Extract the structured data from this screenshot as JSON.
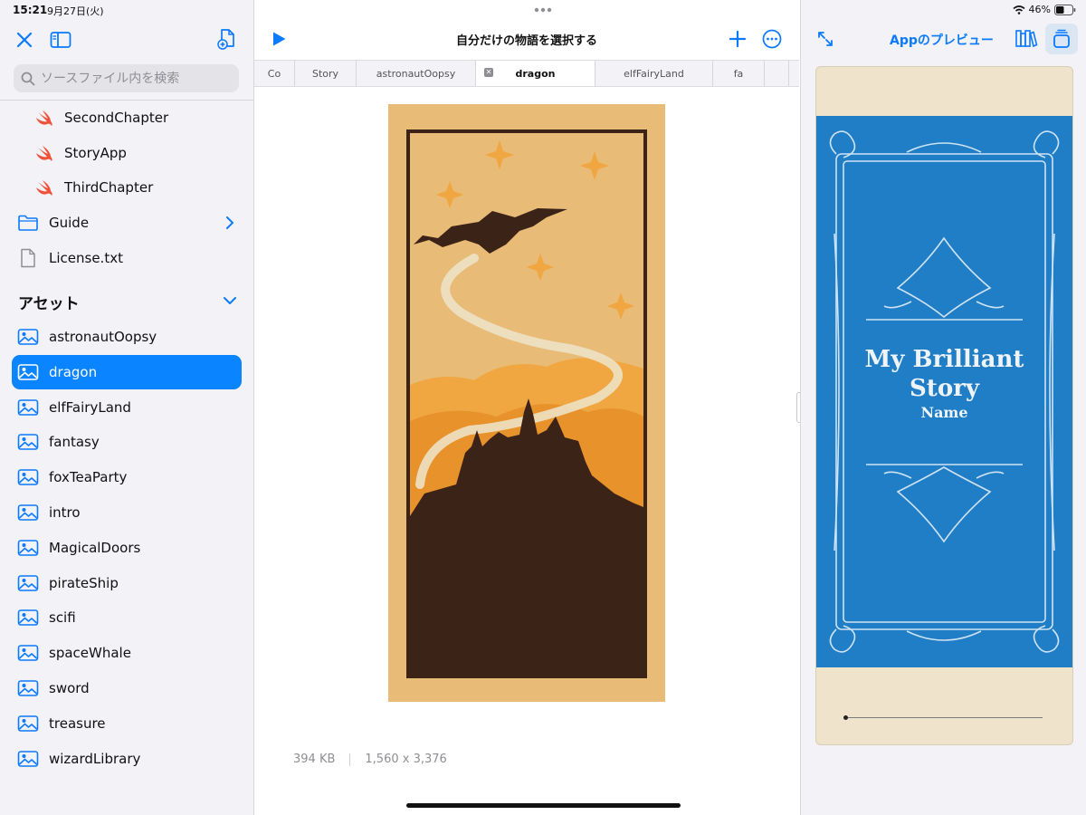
{
  "status": {
    "time": "15:21",
    "date": "9月27日(火)",
    "battery": "46%"
  },
  "sidebar": {
    "search_placeholder": "ソースファイル内を検索",
    "files": [
      {
        "label": "SecondChapter"
      },
      {
        "label": "StoryApp"
      },
      {
        "label": "ThirdChapter"
      },
      {
        "label": "Guide"
      },
      {
        "label": "License.txt"
      }
    ],
    "assets_title": "アセット",
    "assets": [
      {
        "label": "astronautOopsy"
      },
      {
        "label": "dragon"
      },
      {
        "label": "elfFairyLand"
      },
      {
        "label": "fantasy"
      },
      {
        "label": "foxTeaParty"
      },
      {
        "label": "intro"
      },
      {
        "label": "MagicalDoors"
      },
      {
        "label": "pirateShip"
      },
      {
        "label": "scifi"
      },
      {
        "label": "spaceWhale"
      },
      {
        "label": "sword"
      },
      {
        "label": "treasure"
      },
      {
        "label": "wizardLibrary"
      }
    ],
    "selected_asset": "dragon"
  },
  "editor": {
    "title": "自分だけの物語を選択する",
    "tabs": [
      {
        "label": "Co"
      },
      {
        "label": "Story"
      },
      {
        "label": "astronautOopsy"
      },
      {
        "label": "dragon"
      },
      {
        "label": "elfFairyLand"
      },
      {
        "label": "fa"
      }
    ],
    "active_tab": "dragon",
    "file_size": "394 KB",
    "dimensions": "1,560 x 3,376"
  },
  "preview": {
    "title": "Appのプレビュー",
    "cover_title_line1": "My Brilliant",
    "cover_title_line2": "Story",
    "cover_subtitle": "Name"
  },
  "colors": {
    "accent": "#0a84ff",
    "cover_blue": "#1f7ec6",
    "page_cream": "#efe3cb",
    "image_frame": "#e8bb77",
    "silhouette": "#3b2318"
  }
}
